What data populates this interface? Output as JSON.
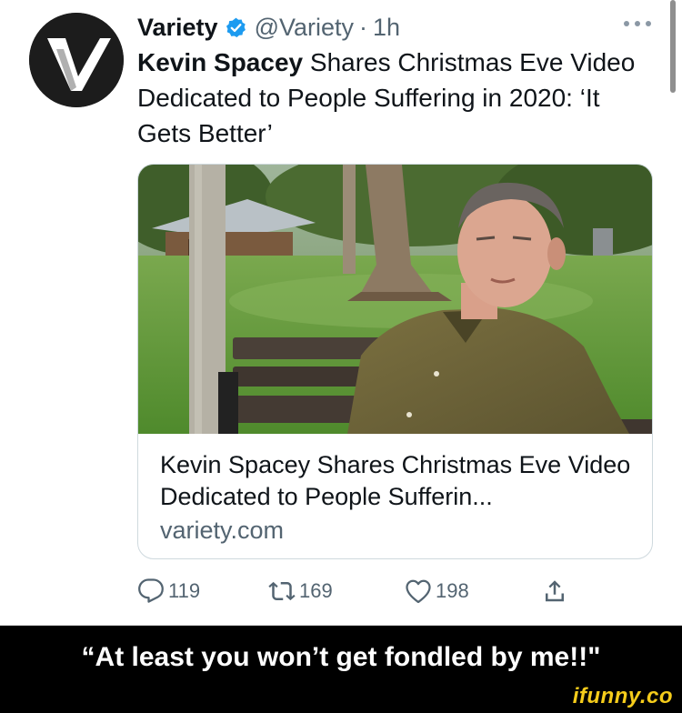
{
  "colors": {
    "accent": "#1d9bf0",
    "text_primary": "#0f1419",
    "text_secondary": "#536471",
    "caption_bg": "#000000",
    "watermark": "#f5cc1b"
  },
  "tweet": {
    "author": {
      "name": "Variety",
      "verified": true,
      "handle": "@Variety",
      "separator": "·",
      "time": "1h",
      "avatar_icon": "variety-v-logo"
    },
    "text": {
      "bold": "Kevin Spacey",
      "rest": " Shares Christmas Eve Video Dedicated to People Suffering in 2020: ‘It Gets Better’"
    },
    "card": {
      "title": "Kevin Spacey Shares Christmas Eve Video Dedicated to People Sufferin...",
      "domain": "variety.com",
      "image": "man-on-park-bench-photo"
    },
    "actions": {
      "reply": {
        "icon": "reply-icon",
        "count": "119"
      },
      "retweet": {
        "icon": "retweet-icon",
        "count": "169"
      },
      "like": {
        "icon": "heart-icon",
        "count": "198"
      },
      "share": {
        "icon": "share-icon"
      }
    }
  },
  "meme": {
    "caption": "“At least you won’t get fondled by me!!\"",
    "watermark": "ifunny.co"
  }
}
